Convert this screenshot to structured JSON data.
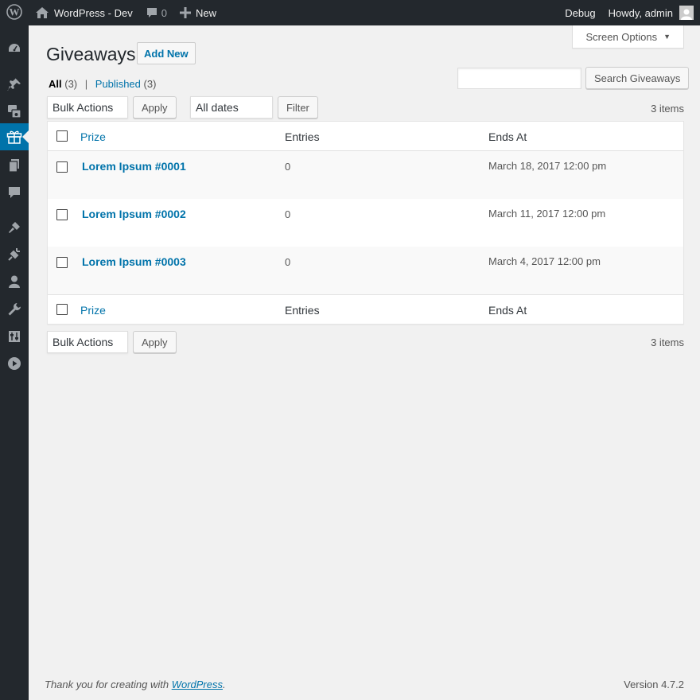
{
  "adminbar": {
    "site_name": "WordPress - Dev",
    "comments_count": "0",
    "new_label": "New",
    "debug_label": "Debug",
    "howdy_label": "Howdy, admin"
  },
  "sidemenu": {
    "icons": [
      "dashboard-icon",
      "pin-icon",
      "media-icon",
      "gift-icon",
      "pages-icon",
      "comments-icon",
      "appearance-icon",
      "plugins-icon",
      "users-icon",
      "tools-icon",
      "settings-icon",
      "video-icon"
    ],
    "active": "gift-icon"
  },
  "screen_options": {
    "label": "Screen Options"
  },
  "page": {
    "title": "Giveaways",
    "add_new_label": "Add New"
  },
  "views": {
    "all_label": "All",
    "all_count": "(3)",
    "separator": "|",
    "published_label": "Published",
    "published_count": "(3)"
  },
  "search": {
    "button_label": "Search Giveaways",
    "value": ""
  },
  "tablenav_top": {
    "bulk_actions": "Bulk Actions",
    "apply_label": "Apply",
    "dates_filter": "All dates",
    "filter_label": "Filter",
    "items_count": "3 items"
  },
  "table": {
    "columns": [
      "Prize",
      "Entries",
      "Ends At"
    ],
    "rows": [
      {
        "prize": "Lorem Ipsum #0001",
        "entries": "0",
        "ends_at": "March 18, 2017 12:00 pm"
      },
      {
        "prize": "Lorem Ipsum #0002",
        "entries": "0",
        "ends_at": "March 11, 2017 12:00 pm"
      },
      {
        "prize": "Lorem Ipsum #0003",
        "entries": "0",
        "ends_at": "March 4, 2017 12:00 pm"
      }
    ]
  },
  "tablenav_bottom": {
    "bulk_actions": "Bulk Actions",
    "apply_label": "Apply",
    "items_count": "3 items"
  },
  "footer": {
    "thanks_prefix": "Thank you for creating with ",
    "thanks_link": "WordPress",
    "thanks_suffix": ".",
    "version": "Version 4.7.2"
  },
  "colors": {
    "adminbar_bg": "#23282d",
    "accent": "#0073aa",
    "page_bg": "#f1f1f1"
  }
}
